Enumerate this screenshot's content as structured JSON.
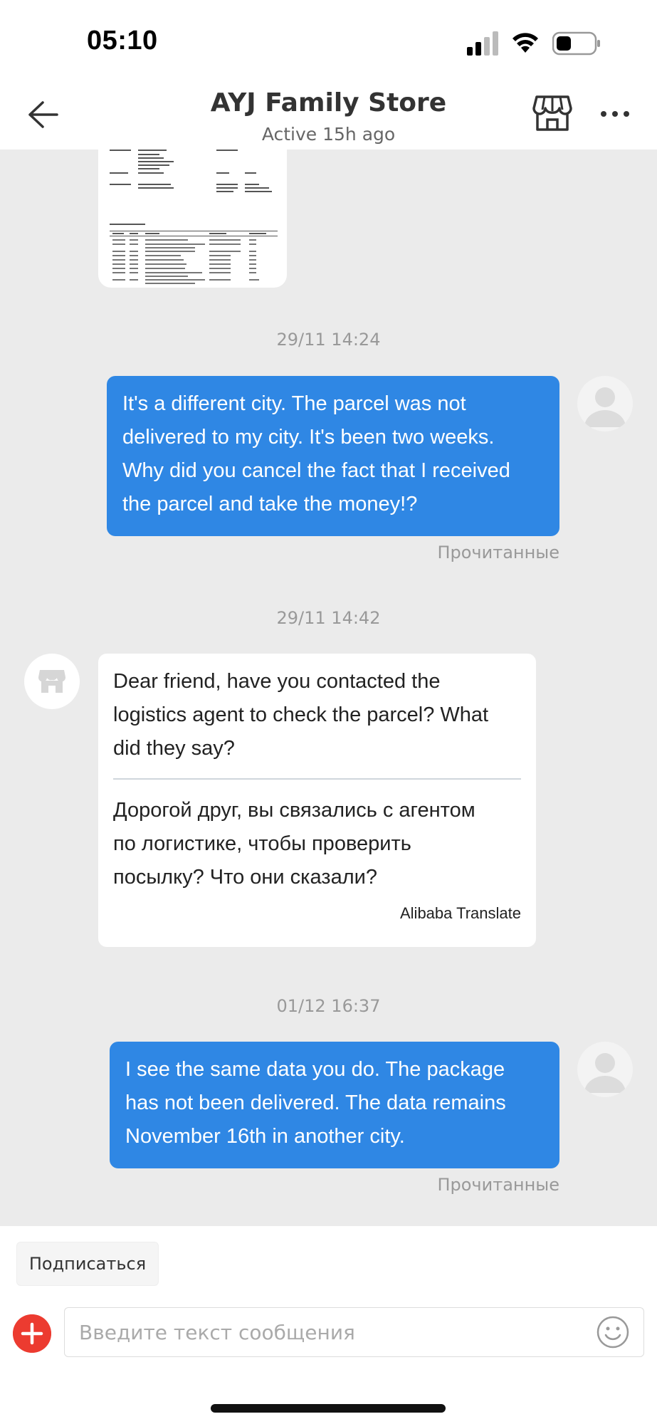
{
  "status_bar": {
    "time": "05:10"
  },
  "header": {
    "store_name": "AYJ Family Store",
    "status": "Active 15h ago"
  },
  "chat": {
    "document_icon": "shipping-document-thumbnail",
    "messages": [
      {
        "timestamp": "29/11 14:24",
        "direction": "outgoing",
        "lines": [
          "It's a different city. The parcel was not",
          "delivered to my city. It's been two weeks.",
          "Why did you cancel the fact that I received",
          "the parcel and take the money!?"
        ],
        "read_status": "Прочитанные"
      },
      {
        "timestamp": "29/11 14:42",
        "direction": "incoming",
        "original_lines": [
          "Dear friend, have you contacted the",
          "logistics agent to check the parcel? What",
          "did they say?"
        ],
        "translated_lines": [
          "Дорогой друг, вы связались с агентом",
          "по логистике, чтобы проверить",
          "посылку? Что они сказали?"
        ],
        "translation_credit": "Alibaba Translate"
      },
      {
        "timestamp": "01/12 16:37",
        "direction": "outgoing",
        "lines": [
          "I see the same data you do. The package",
          "has not been delivered. The data remains",
          "November 16th in another city."
        ],
        "read_status": "Прочитанные"
      }
    ]
  },
  "bottom": {
    "subscribe_label": "Подписаться",
    "input_placeholder": "Введите текст сообщения"
  },
  "colors": {
    "outgoing_bubble": "#2f87e4",
    "chat_background": "#ebebeb",
    "add_button": "#ec3b30"
  }
}
